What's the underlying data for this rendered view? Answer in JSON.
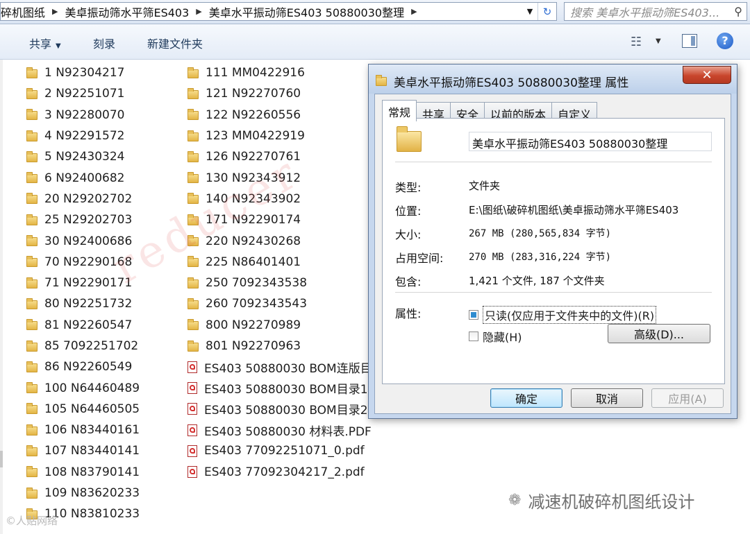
{
  "addressbar": {
    "crumbs": [
      "碎机图纸",
      "美卓振动筛水平筛ES403",
      "美卓水平振动筛ES403  50880030整理"
    ],
    "search_placeholder": "搜索 美卓水平振动筛ES403..."
  },
  "toolbar": {
    "share": "共享",
    "burn": "刻录",
    "new_folder": "新建文件夹"
  },
  "files_col1": [
    "1  N92304217",
    "2  N92251071",
    "3  N92280070",
    "4  N92291572",
    "5  N92430324",
    "6  N92400682",
    "20  N29202702",
    "25  N29202703",
    "30  N92400686",
    "70  N92290168",
    "71  N92290171",
    "80  N92251732",
    "81  N92260547",
    "85  7092251702",
    "86  N92260549",
    "100  N64460489",
    "105  N64460505",
    "106  N83440161",
    "107  N83440141",
    "108  N83790141",
    "109  N83620233",
    "110  N83810233"
  ],
  "files_col2_folders": [
    "111  MM0422916",
    "121  N92270760",
    "122  N92260556",
    "123  MM0422919",
    "126  N92270761",
    "130  N92343912",
    "140  N92343902",
    "171  N92290174",
    "220  N92430268",
    "225  N86401401",
    "250  7092343538",
    "260  7092343543",
    "800  N92270989",
    "801  N92270963"
  ],
  "files_col2_pdfs": [
    "ES403  50880030 BOM连版目",
    "ES403  50880030 BOM目录1",
    "ES403  50880030 BOM目录2",
    "ES403  50880030 材料表.PDF",
    "ES403  77092251071_0.pdf",
    "ES403  77092304217_2.pdf"
  ],
  "dialog": {
    "title": "美卓水平振动筛ES403  50880030整理 属性",
    "close": "✕",
    "tabs": [
      "常规",
      "共享",
      "安全",
      "以前的版本",
      "自定义"
    ],
    "name": "美卓水平振动筛ES403  50880030整理",
    "type_label": "类型:",
    "type_value": "文件夹",
    "location_label": "位置:",
    "location_value": "E:\\图纸\\破碎机图纸\\美卓振动筛水平筛ES403",
    "size_label": "大小:",
    "size_value": "267 MB (280,565,834 字节)",
    "disk_label": "占用空间:",
    "disk_value": "270 MB (283,316,224 字节)",
    "contains_label": "包含:",
    "contains_value": "1,421 个文件, 187 个文件夹",
    "attributes_label": "属性:",
    "readonly": "只读(仅应用于文件夹中的文件)(R)",
    "hidden": "隐藏(H)",
    "advanced": "高级(D)...",
    "ok": "确定",
    "cancel": "取消",
    "apply": "应用(A)"
  },
  "watermark": "reducer",
  "brand": "减速机破碎机图纸设计",
  "corner_logo": "©人贴网络"
}
